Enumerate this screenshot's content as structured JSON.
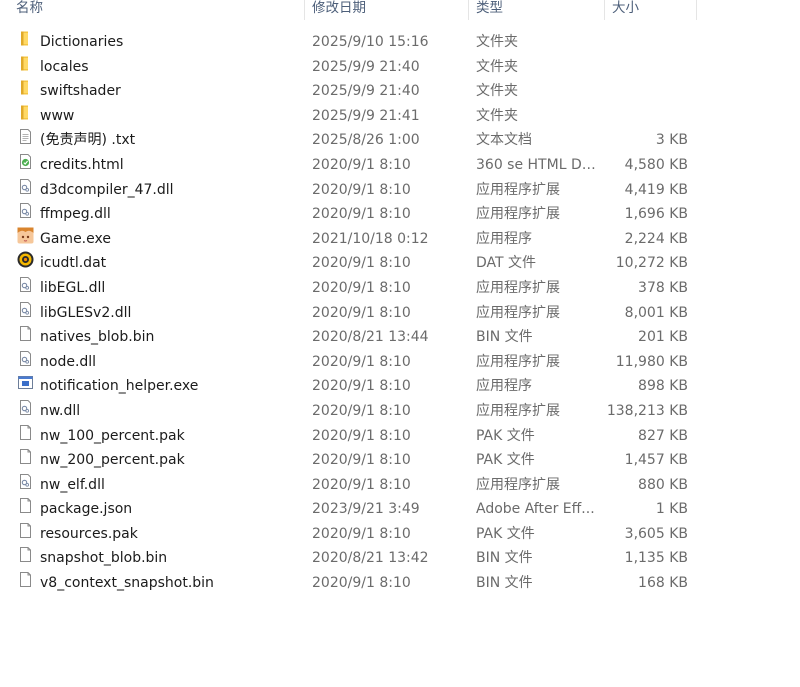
{
  "columns": {
    "name": "名称",
    "date": "修改日期",
    "type": "类型",
    "size": "大小"
  },
  "files": [
    {
      "name": "Dictionaries",
      "date": "2025/9/10 15:16",
      "type": "文件夹",
      "size": "",
      "icon": "folder-icon"
    },
    {
      "name": "locales",
      "date": "2025/9/9 21:40",
      "type": "文件夹",
      "size": "",
      "icon": "folder-icon"
    },
    {
      "name": "swiftshader",
      "date": "2025/9/9 21:40",
      "type": "文件夹",
      "size": "",
      "icon": "folder-icon"
    },
    {
      "name": "www",
      "date": "2025/9/9 21:41",
      "type": "文件夹",
      "size": "",
      "icon": "folder-icon"
    },
    {
      "name": "(免责声明) .txt",
      "date": "2025/8/26 1:00",
      "type": "文本文档",
      "size": "3 KB",
      "icon": "text-file-icon"
    },
    {
      "name": "credits.html",
      "date": "2020/9/1 8:10",
      "type": "360 se HTML Do...",
      "size": "4,580 KB",
      "icon": "html-file-icon"
    },
    {
      "name": "d3dcompiler_47.dll",
      "date": "2020/9/1 8:10",
      "type": "应用程序扩展",
      "size": "4,419 KB",
      "icon": "dll-file-icon"
    },
    {
      "name": "ffmpeg.dll",
      "date": "2020/9/1 8:10",
      "type": "应用程序扩展",
      "size": "1,696 KB",
      "icon": "dll-file-icon"
    },
    {
      "name": "Game.exe",
      "date": "2021/10/18 0:12",
      "type": "应用程序",
      "size": "2,224 KB",
      "icon": "game-exe-icon"
    },
    {
      "name": "icudtl.dat",
      "date": "2020/9/1 8:10",
      "type": "DAT 文件",
      "size": "10,272 KB",
      "icon": "dat-file-icon"
    },
    {
      "name": "libEGL.dll",
      "date": "2020/9/1 8:10",
      "type": "应用程序扩展",
      "size": "378 KB",
      "icon": "dll-file-icon"
    },
    {
      "name": "libGLESv2.dll",
      "date": "2020/9/1 8:10",
      "type": "应用程序扩展",
      "size": "8,001 KB",
      "icon": "dll-file-icon"
    },
    {
      "name": "natives_blob.bin",
      "date": "2020/8/21 13:44",
      "type": "BIN 文件",
      "size": "201 KB",
      "icon": "blank-file-icon"
    },
    {
      "name": "node.dll",
      "date": "2020/9/1 8:10",
      "type": "应用程序扩展",
      "size": "11,980 KB",
      "icon": "dll-file-icon"
    },
    {
      "name": "notification_helper.exe",
      "date": "2020/9/1 8:10",
      "type": "应用程序",
      "size": "898 KB",
      "icon": "exe-file-icon"
    },
    {
      "name": "nw.dll",
      "date": "2020/9/1 8:10",
      "type": "应用程序扩展",
      "size": "138,213 KB",
      "icon": "dll-file-icon"
    },
    {
      "name": "nw_100_percent.pak",
      "date": "2020/9/1 8:10",
      "type": "PAK 文件",
      "size": "827 KB",
      "icon": "blank-file-icon"
    },
    {
      "name": "nw_200_percent.pak",
      "date": "2020/9/1 8:10",
      "type": "PAK 文件",
      "size": "1,457 KB",
      "icon": "blank-file-icon"
    },
    {
      "name": "nw_elf.dll",
      "date": "2020/9/1 8:10",
      "type": "应用程序扩展",
      "size": "880 KB",
      "icon": "dll-file-icon"
    },
    {
      "name": "package.json",
      "date": "2023/9/21 3:49",
      "type": "Adobe After Eff...",
      "size": "1 KB",
      "icon": "blank-file-icon"
    },
    {
      "name": "resources.pak",
      "date": "2020/9/1 8:10",
      "type": "PAK 文件",
      "size": "3,605 KB",
      "icon": "blank-file-icon"
    },
    {
      "name": "snapshot_blob.bin",
      "date": "2020/8/21 13:42",
      "type": "BIN 文件",
      "size": "1,135 KB",
      "icon": "blank-file-icon"
    },
    {
      "name": "v8_context_snapshot.bin",
      "date": "2020/9/1 8:10",
      "type": "BIN 文件",
      "size": "168 KB",
      "icon": "blank-file-icon"
    }
  ]
}
